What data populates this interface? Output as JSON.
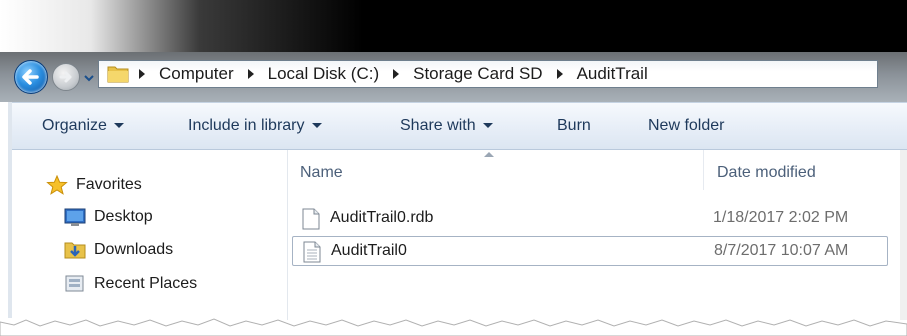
{
  "breadcrumb": [
    "Computer",
    "Local Disk (C:)",
    "Storage Card SD",
    "AuditTrail"
  ],
  "toolbar": {
    "organize": "Organize",
    "include_in_library": "Include in library",
    "share_with": "Share with",
    "burn": "Burn",
    "new_folder": "New folder"
  },
  "sidebar": {
    "favorites": "Favorites",
    "items": [
      "Desktop",
      "Downloads",
      "Recent Places"
    ]
  },
  "columns": {
    "name": "Name",
    "date_modified": "Date modified"
  },
  "files": [
    {
      "name": "AuditTrail0.rdb",
      "date": "1/18/2017 2:02 PM"
    },
    {
      "name": "AuditTrail0",
      "date": "8/7/2017 10:07 AM"
    }
  ],
  "colors": {
    "toolbar_text": "#1e395b",
    "column_header_text": "#4c607a",
    "selection_border": "#a6b3c4"
  }
}
